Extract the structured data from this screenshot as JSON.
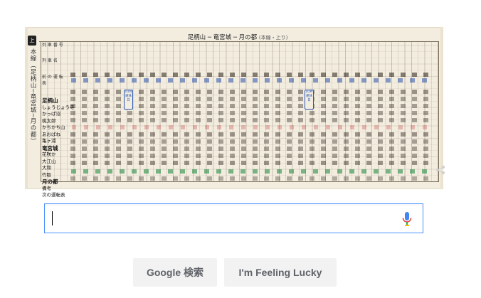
{
  "doodle": {
    "title": "足柄山 ─ 竜宮城 ─ 月の都",
    "subtitle": "(本線・上り)",
    "side_badge": "上り",
    "side_text": "本線（足柄山─竜宮城─月の都）",
    "header_labels": [
      "列 車 番 号",
      "列 車 名",
      "前 の 運 転 表"
    ],
    "stations": [
      {
        "name": "足柄山",
        "big": true
      },
      {
        "name": "しょうじょう寺",
        "big": false
      },
      {
        "name": "かっぱ沼",
        "big": false
      },
      {
        "name": "桃太郎",
        "big": false
      },
      {
        "name": "かちかち山",
        "big": false
      },
      {
        "name": "あおばね",
        "big": false
      },
      {
        "name": "亀ヶ浦",
        "big": false
      },
      {
        "name": "竜宮城",
        "big": true
      },
      {
        "name": "花咲か",
        "big": false
      },
      {
        "name": "大江山",
        "big": false
      },
      {
        "name": "大和",
        "big": false
      },
      {
        "name": "竹取",
        "big": false
      },
      {
        "name": "月の都",
        "big": true
      },
      {
        "name": "備考",
        "big": false
      },
      {
        "name": "次の運転表",
        "big": false
      }
    ],
    "callout_text": "10月運休日",
    "accent_blue": "#2a57b5",
    "accent_green": "#2c8c46",
    "paper_color": "#f3ede0"
  },
  "search": {
    "value": "",
    "mic_icon": "microphone-icon"
  },
  "buttons": {
    "search_label": "Google 検索",
    "lucky_label": "I'm Feeling Lucky"
  }
}
